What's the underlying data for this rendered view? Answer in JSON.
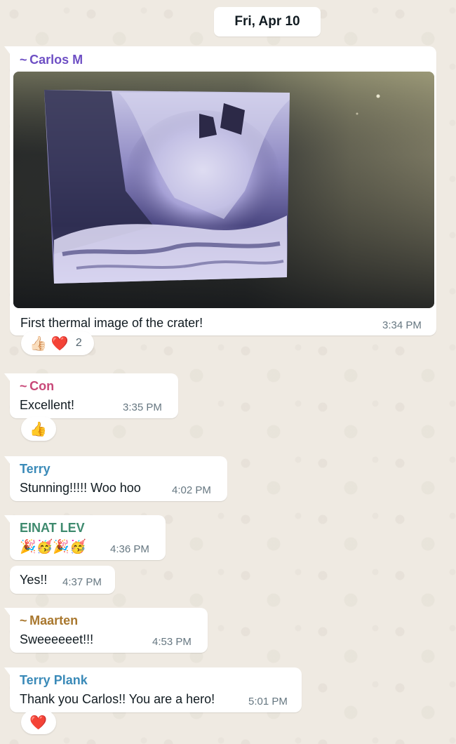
{
  "date_separator": "Fri, Apr 10",
  "colors": {
    "carlos": "#6e4fc4",
    "con": "#c84878",
    "terry": "#3a8ab8",
    "einat": "#3e8a6e",
    "maarten": "#a9782f",
    "terry_plank": "#3a8ab8"
  },
  "messages": [
    {
      "sender": "~ Carlos M",
      "has_photo": true,
      "text": "First thermal image of the crater!",
      "time": "3:34 PM",
      "reactions": {
        "emojis": [
          "👍🏻",
          "❤️"
        ],
        "count": "2"
      }
    },
    {
      "sender": "~ Con",
      "text": "Excellent!",
      "time": "3:35 PM",
      "reactions": {
        "emojis": [
          "👍"
        ]
      }
    },
    {
      "sender": "Terry",
      "text": "Stunning!!!!!  Woo hoo",
      "time": "4:02 PM"
    },
    {
      "sender": "EINAT LEV",
      "text": "🎉🥳🎉🥳",
      "time": "4:36 PM"
    },
    {
      "sender": "",
      "text": "Yes!!",
      "time": "4:37 PM"
    },
    {
      "sender": "~ Maarten",
      "text": "Sweeeeeet!!!",
      "time": "4:53 PM"
    },
    {
      "sender": "Terry Plank",
      "text": "Thank you Carlos!! You are a hero!",
      "time": "5:01 PM",
      "reactions": {
        "emojis": [
          "❤️"
        ]
      }
    }
  ]
}
